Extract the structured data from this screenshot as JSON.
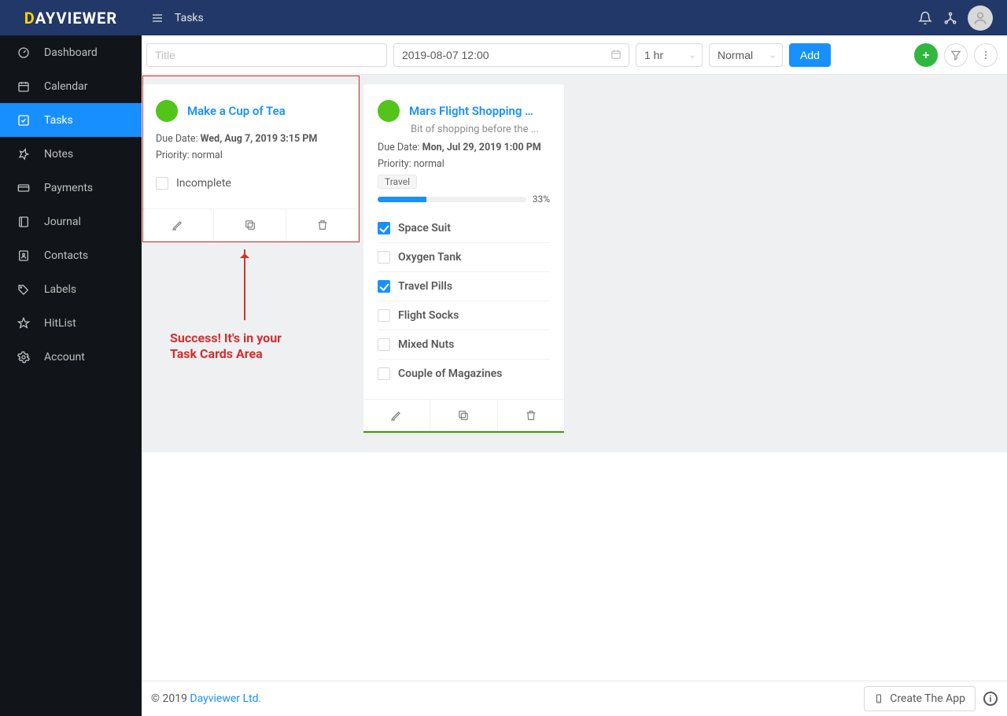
{
  "brand": {
    "prefix": "D",
    "rest": "AYVIEWER"
  },
  "breadcrumb": "Tasks",
  "sidebar": {
    "items": [
      {
        "label": "Dashboard"
      },
      {
        "label": "Calendar"
      },
      {
        "label": "Tasks"
      },
      {
        "label": "Notes"
      },
      {
        "label": "Payments"
      },
      {
        "label": "Journal"
      },
      {
        "label": "Contacts"
      },
      {
        "label": "Labels"
      },
      {
        "label": "HitList"
      },
      {
        "label": "Account"
      }
    ]
  },
  "toolbar": {
    "title_placeholder": "Title",
    "date_value": "2019-08-07 12:00",
    "duration": "1 hr",
    "priority": "Normal",
    "add_label": "Add"
  },
  "cards": [
    {
      "title": "Make a Cup of Tea",
      "due_label": "Due Date: ",
      "due_value": "Wed, Aug 7, 2019 3:15 PM",
      "priority_line": "Priority: normal",
      "incomplete_label": "Incomplete"
    },
    {
      "title": "Mars Flight Shopping …",
      "desc": "Bit of shopping before the ...",
      "due_label": "Due Date: ",
      "due_value": "Mon, Jul 29, 2019 1:00 PM",
      "priority_line": "Priority: normal",
      "tag": "Travel",
      "progress_pct": 33,
      "progress_text": "33%",
      "items": [
        {
          "label": "Space Suit",
          "done": true
        },
        {
          "label": "Oxygen Tank",
          "done": false
        },
        {
          "label": "Travel Pills",
          "done": true
        },
        {
          "label": "Flight Socks",
          "done": false
        },
        {
          "label": "Mixed Nuts",
          "done": false
        },
        {
          "label": "Couple of Magazines",
          "done": false
        }
      ]
    }
  ],
  "annotation": {
    "line1": "Success! It's in your",
    "line2": "Task Cards Area"
  },
  "footer": {
    "copyright": "© 2019 ",
    "link": "Dayviewer Ltd.",
    "create_app": "Create The App"
  }
}
